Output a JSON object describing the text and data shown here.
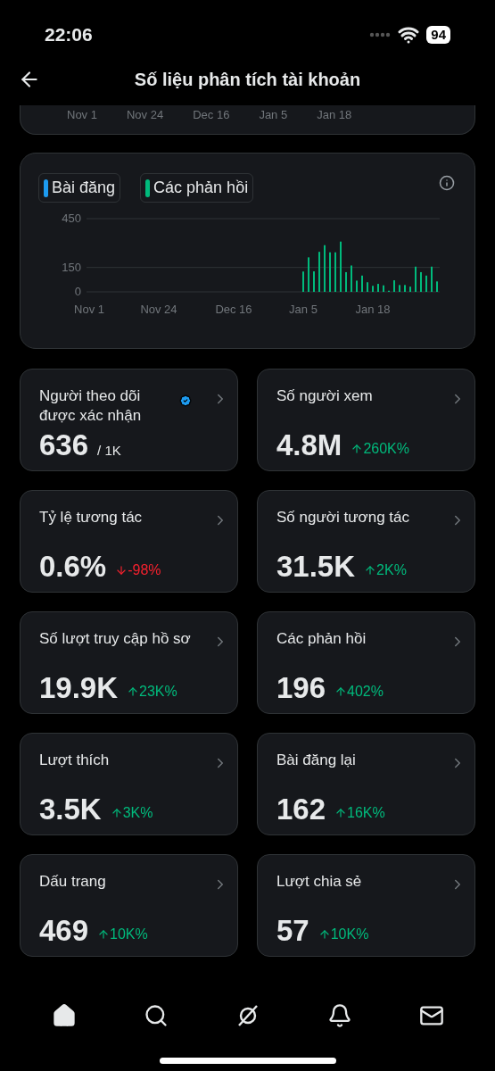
{
  "status_bar": {
    "time": "22:06",
    "battery": "94"
  },
  "header": {
    "title": "Số liệu phân tích tài khoản"
  },
  "previous_chart": {
    "xlabels": [
      "Nov 1",
      "Nov 24",
      "Dec 16",
      "Jan 5",
      "Jan 18"
    ]
  },
  "chart_data": {
    "type": "bar",
    "ylim": [
      0,
      450
    ],
    "yticks": [
      0,
      150,
      450
    ],
    "categories": [
      "Nov 1",
      null,
      null,
      null,
      null,
      null,
      null,
      null,
      null,
      null,
      null,
      null,
      null,
      "Nov 24",
      null,
      null,
      null,
      null,
      null,
      null,
      null,
      null,
      null,
      null,
      null,
      null,
      null,
      "Dec 16",
      null,
      null,
      null,
      null,
      null,
      null,
      null,
      null,
      null,
      null,
      null,
      null,
      "Jan 5",
      null,
      null,
      null,
      null,
      null,
      null,
      null,
      null,
      null,
      null,
      null,
      null,
      "Jan 18",
      null,
      null,
      null,
      null,
      null,
      null,
      null,
      null,
      null,
      null,
      null,
      null
    ],
    "series": [
      {
        "name": "Bài đăng",
        "color": "#1d9bf0",
        "values": [
          null,
          null,
          null,
          null,
          null,
          null,
          null,
          null,
          null,
          null,
          null,
          null,
          null,
          null,
          null,
          null,
          null,
          null,
          null,
          null,
          null,
          null,
          null,
          null,
          null,
          null,
          null,
          null,
          null,
          null,
          null,
          null,
          null,
          null,
          null,
          null,
          null,
          null,
          null,
          null,
          null,
          null,
          null,
          null,
          null,
          null,
          null,
          null,
          null,
          null,
          null,
          null,
          null,
          null,
          null,
          null,
          null,
          null,
          null,
          null,
          null,
          null,
          null,
          null,
          null,
          null
        ]
      },
      {
        "name": "Các phản hồi",
        "color": "#00ba7c",
        "values": [
          null,
          null,
          null,
          null,
          null,
          null,
          null,
          null,
          null,
          null,
          null,
          null,
          null,
          null,
          null,
          null,
          null,
          null,
          null,
          null,
          null,
          null,
          null,
          null,
          null,
          null,
          null,
          null,
          null,
          null,
          null,
          null,
          null,
          null,
          null,
          null,
          null,
          null,
          null,
          null,
          125,
          212,
          126,
          246,
          287,
          243,
          243,
          309,
          121,
          162,
          69,
          100,
          59,
          37,
          49,
          40,
          7,
          71,
          42,
          42,
          32,
          155,
          121,
          100,
          155,
          64
        ]
      }
    ]
  },
  "metrics": [
    {
      "title": "Người theo dõi được xác nhận",
      "verified": true,
      "value": "636",
      "kind": "total",
      "sub": "/ 1K"
    },
    {
      "title": "Số người xem",
      "verified": false,
      "value": "4.8M",
      "kind": "up",
      "sub": "260K%"
    },
    {
      "title": "Tỷ lệ tương tác",
      "verified": false,
      "value": "0.6%",
      "kind": "down",
      "sub": "-98%"
    },
    {
      "title": "Số người tương tác",
      "verified": false,
      "value": "31.5K",
      "kind": "up",
      "sub": "2K%"
    },
    {
      "title": "Số lượt truy cập hồ sơ",
      "verified": false,
      "value": "19.9K",
      "kind": "up",
      "sub": "23K%"
    },
    {
      "title": "Các phản hồi",
      "verified": false,
      "value": "196",
      "kind": "up",
      "sub": "402%"
    },
    {
      "title": "Lượt thích",
      "verified": false,
      "value": "3.5K",
      "kind": "up",
      "sub": "3K%"
    },
    {
      "title": "Bài đăng lại",
      "verified": false,
      "value": "162",
      "kind": "up",
      "sub": "16K%"
    },
    {
      "title": "Dấu trang",
      "verified": false,
      "value": "469",
      "kind": "up",
      "sub": "10K%"
    },
    {
      "title": "Lượt chia sẻ",
      "verified": false,
      "value": "57",
      "kind": "up",
      "sub": "10K%"
    }
  ],
  "tab_bar": [
    {
      "kind": "home",
      "selected": true
    },
    {
      "kind": "search",
      "selected": false
    },
    {
      "kind": "grok",
      "selected": false
    },
    {
      "kind": "bell",
      "selected": false
    },
    {
      "kind": "mail",
      "selected": false
    }
  ]
}
